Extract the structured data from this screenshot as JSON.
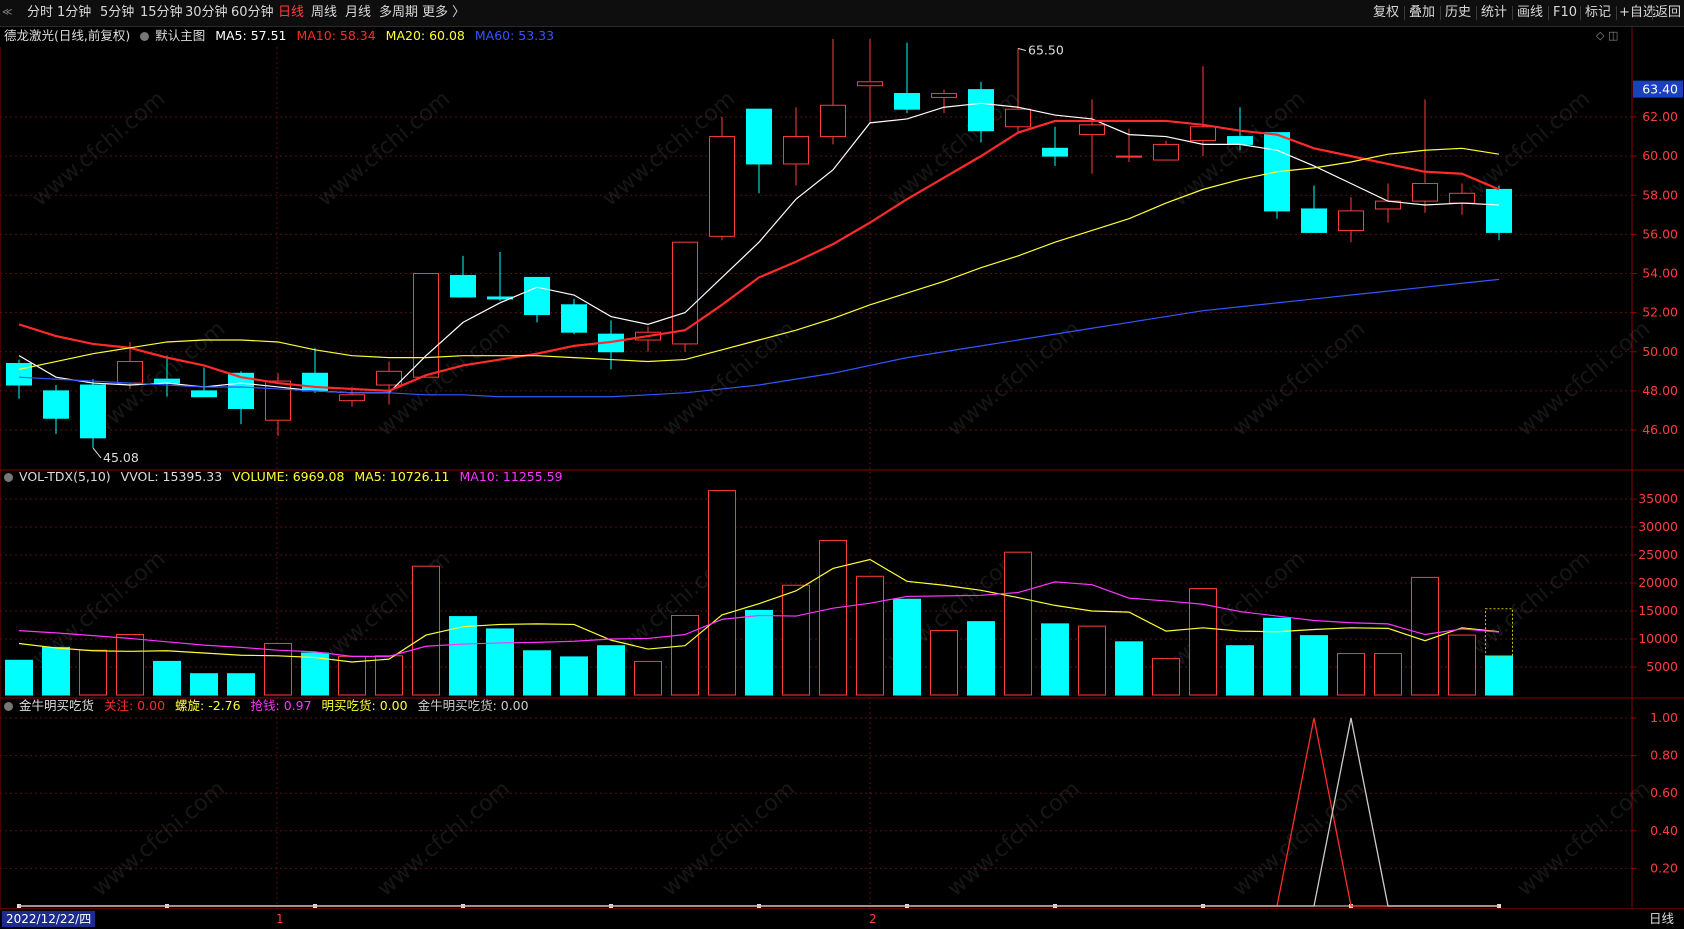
{
  "toolbar": {
    "left_items": [
      "分时",
      "1分钟",
      "5分钟",
      "15分钟",
      "30分钟",
      "60分钟",
      "日线",
      "周线",
      "月线",
      "多周期",
      "更多 〉"
    ],
    "active_item": "日线",
    "right_items": [
      "复权",
      "叠加",
      "历史",
      "统计",
      "画线",
      "F10",
      "标记",
      "+自选",
      "返回"
    ]
  },
  "main_panel": {
    "stock_label": "德龙激光(日线,前复权)",
    "template_label": "默认主图",
    "ma5": {
      "label": "MA5: 57.51",
      "color": "#ffffff"
    },
    "ma10": {
      "label": "MA10: 58.34",
      "color": "#ff2a2a"
    },
    "ma20": {
      "label": "MA20: 60.08",
      "color": "#ffff33"
    },
    "ma60": {
      "label": "MA60: 53.33",
      "color": "#3355ff"
    },
    "last_price_tag": "63.40"
  },
  "volume_panel": {
    "title": "VOL-TDX(5,10)",
    "vvol": "VVOL: 15395.33",
    "volume": "VOLUME: 6969.08",
    "ma5": "MA5: 10726.11",
    "ma10": "MA10: 11255.59"
  },
  "indicator_panel": {
    "title": "金牛明买吃货",
    "guanzhu": "关注: 0.00",
    "luoxuan": "螺旋: -2.76",
    "qiangqian": "抢钱: 0.97",
    "mingmai": "明买吃货: 0.00",
    "jinniu": "金牛明买吃货: 0.00"
  },
  "bottom": {
    "date": "2022/12/22/四",
    "period": "日线",
    "month_markers": [
      "1",
      "2"
    ]
  },
  "chart_data": [
    {
      "type": "candlestick",
      "title": "德龙激光(日线,前复权)",
      "ylim": [
        44.0,
        67.0
      ],
      "yticks": [
        46.0,
        48.0,
        50.0,
        52.0,
        54.0,
        56.0,
        58.0,
        60.0,
        62.0
      ],
      "annotations": [
        {
          "text": "65.50",
          "type": "high",
          "index": 27
        },
        {
          "text": "45.08",
          "type": "low",
          "index": 2
        }
      ],
      "candles": [
        {
          "o": 49.4,
          "h": 49.6,
          "l": 47.6,
          "c": 48.3
        },
        {
          "o": 48.0,
          "h": 48.3,
          "l": 45.8,
          "c": 46.6
        },
        {
          "o": 48.3,
          "h": 48.6,
          "l": 45.08,
          "c": 45.6
        },
        {
          "o": 48.4,
          "h": 50.5,
          "l": 48.1,
          "c": 49.5
        },
        {
          "o": 48.6,
          "h": 49.8,
          "l": 47.7,
          "c": 48.4
        },
        {
          "o": 48.0,
          "h": 49.2,
          "l": 47.8,
          "c": 47.7
        },
        {
          "o": 48.9,
          "h": 49.0,
          "l": 46.3,
          "c": 47.1
        },
        {
          "o": 46.5,
          "h": 48.9,
          "l": 45.7,
          "c": 48.5
        },
        {
          "o": 48.9,
          "h": 50.2,
          "l": 47.9,
          "c": 48.0
        },
        {
          "o": 47.5,
          "h": 48.2,
          "l": 47.2,
          "c": 47.8
        },
        {
          "o": 48.3,
          "h": 49.5,
          "l": 47.3,
          "c": 49.0
        },
        {
          "o": 48.7,
          "h": 54.0,
          "l": 48.7,
          "c": 54.0
        },
        {
          "o": 53.9,
          "h": 54.9,
          "l": 52.8,
          "c": 52.8
        },
        {
          "o": 52.8,
          "h": 55.1,
          "l": 52.6,
          "c": 52.7
        },
        {
          "o": 53.8,
          "h": 53.8,
          "l": 51.5,
          "c": 51.9
        },
        {
          "o": 52.4,
          "h": 52.7,
          "l": 50.9,
          "c": 51.0
        },
        {
          "o": 50.9,
          "h": 51.6,
          "l": 49.1,
          "c": 50.0
        },
        {
          "o": 50.6,
          "h": 51.3,
          "l": 50.0,
          "c": 51.0
        },
        {
          "o": 50.4,
          "h": 55.6,
          "l": 50.0,
          "c": 55.6
        },
        {
          "o": 55.9,
          "h": 62.0,
          "l": 55.7,
          "c": 61.0
        },
        {
          "o": 62.4,
          "h": 62.4,
          "l": 58.1,
          "c": 59.6
        },
        {
          "o": 59.6,
          "h": 62.5,
          "l": 58.5,
          "c": 61.0
        },
        {
          "o": 61.0,
          "h": 66.0,
          "l": 60.6,
          "c": 62.6
        },
        {
          "o": 63.6,
          "h": 66.0,
          "l": 61.7,
          "c": 63.8
        },
        {
          "o": 63.2,
          "h": 65.8,
          "l": 62.2,
          "c": 62.4
        },
        {
          "o": 63.0,
          "h": 63.4,
          "l": 62.2,
          "c": 63.2
        },
        {
          "o": 63.4,
          "h": 63.8,
          "l": 60.7,
          "c": 61.3
        },
        {
          "o": 61.5,
          "h": 65.5,
          "l": 61.2,
          "c": 62.4
        },
        {
          "o": 60.4,
          "h": 61.5,
          "l": 59.5,
          "c": 60.0
        },
        {
          "o": 61.1,
          "h": 62.9,
          "l": 59.1,
          "c": 61.6
        },
        {
          "o": 60.0,
          "h": 61.4,
          "l": 59.7,
          "c": 60.0
        },
        {
          "o": 59.8,
          "h": 60.8,
          "l": 59.8,
          "c": 60.6
        },
        {
          "o": 60.8,
          "h": 64.6,
          "l": 60.0,
          "c": 61.5
        },
        {
          "o": 61.0,
          "h": 62.5,
          "l": 60.3,
          "c": 60.6
        },
        {
          "o": 61.2,
          "h": 61.2,
          "l": 56.8,
          "c": 57.2
        },
        {
          "o": 57.3,
          "h": 58.5,
          "l": 56.1,
          "c": 56.1
        },
        {
          "o": 56.2,
          "h": 57.9,
          "l": 55.6,
          "c": 57.2
        },
        {
          "o": 57.3,
          "h": 58.6,
          "l": 56.6,
          "c": 57.7
        },
        {
          "o": 57.7,
          "h": 62.9,
          "l": 57.1,
          "c": 58.6
        },
        {
          "o": 57.6,
          "h": 58.6,
          "l": 57.0,
          "c": 58.1
        },
        {
          "o": 58.3,
          "h": 58.5,
          "l": 55.7,
          "c": 56.1
        }
      ],
      "series": [
        {
          "name": "MA5",
          "color": "#ffffff",
          "values": [
            49.8,
            48.7,
            48.4,
            48.3,
            48.4,
            48.2,
            48.4,
            48.2,
            48.0,
            47.9,
            47.9,
            49.8,
            51.5,
            52.5,
            53.3,
            52.9,
            51.8,
            51.4,
            52.0,
            53.8,
            55.6,
            57.8,
            59.3,
            61.7,
            61.9,
            62.5,
            62.7,
            62.5,
            62.1,
            61.9,
            61.1,
            61.0,
            60.6,
            60.6,
            60.3,
            59.5,
            58.6,
            57.7,
            57.5,
            57.6,
            57.5
          ]
        },
        {
          "name": "MA10",
          "color": "#ff2a2a",
          "values": [
            51.4,
            50.8,
            50.4,
            50.2,
            49.7,
            49.3,
            48.7,
            48.4,
            48.2,
            48.1,
            48.0,
            48.8,
            49.3,
            49.6,
            49.9,
            50.3,
            50.5,
            50.8,
            51.1,
            52.4,
            53.8,
            54.6,
            55.5,
            56.6,
            57.8,
            58.9,
            60.0,
            61.2,
            61.8,
            61.8,
            61.8,
            61.8,
            61.6,
            61.3,
            61.1,
            60.4,
            60.0,
            59.6,
            59.2,
            59.1,
            58.3
          ]
        },
        {
          "name": "MA20",
          "color": "#ffff33",
          "values": [
            49.1,
            49.5,
            49.9,
            50.2,
            50.5,
            50.6,
            50.6,
            50.5,
            50.1,
            49.8,
            49.7,
            49.7,
            49.8,
            49.8,
            49.8,
            49.7,
            49.6,
            49.5,
            49.6,
            50.1,
            50.6,
            51.1,
            51.7,
            52.4,
            53.0,
            53.6,
            54.3,
            54.9,
            55.6,
            56.2,
            56.8,
            57.6,
            58.3,
            58.8,
            59.2,
            59.4,
            59.7,
            60.1,
            60.3,
            60.4,
            60.1
          ]
        },
        {
          "name": "MA60",
          "color": "#3355ff",
          "values": [
            48.7,
            48.6,
            48.5,
            48.4,
            48.3,
            48.2,
            48.2,
            48.1,
            48.0,
            47.9,
            47.9,
            47.8,
            47.8,
            47.7,
            47.7,
            47.7,
            47.7,
            47.8,
            47.9,
            48.1,
            48.3,
            48.6,
            48.9,
            49.3,
            49.7,
            50.0,
            50.3,
            50.6,
            50.9,
            51.2,
            51.5,
            51.8,
            52.1,
            52.3,
            52.5,
            52.7,
            52.9,
            53.1,
            53.3,
            53.5,
            53.7
          ]
        }
      ]
    },
    {
      "type": "bar",
      "title": "VOL-TDX(5,10)",
      "ylim": [
        0,
        37000
      ],
      "yticks": [
        5000,
        10000,
        15000,
        20000,
        25000,
        30000,
        35000
      ],
      "values": [
        6200,
        8500,
        8000,
        10800,
        6000,
        3800,
        3800,
        9200,
        7500,
        6900,
        7000,
        23000,
        14000,
        11800,
        7900,
        6800,
        8800,
        6000,
        14200,
        36500,
        15100,
        19600,
        27600,
        21200,
        17100,
        11500,
        13100,
        25500,
        12700,
        12300,
        9500,
        6500,
        19000,
        8800,
        13700,
        10600,
        7400,
        7400,
        21000,
        10700,
        6969.08
      ],
      "up": [
        false,
        false,
        true,
        true,
        false,
        false,
        false,
        true,
        false,
        true,
        true,
        true,
        false,
        false,
        false,
        false,
        false,
        true,
        true,
        true,
        false,
        true,
        true,
        true,
        false,
        true,
        false,
        true,
        false,
        true,
        false,
        true,
        true,
        false,
        false,
        false,
        true,
        true,
        true,
        true,
        false
      ],
      "series": [
        {
          "name": "MA5",
          "color": "#ffff33",
          "values": [
            9200,
            8400,
            7900,
            7800,
            7900,
            7500,
            7100,
            7000,
            6700,
            5900,
            6400,
            10700,
            12200,
            12600,
            12700,
            12600,
            9800,
            8200,
            8800,
            14300,
            16300,
            18600,
            22600,
            24200,
            20300,
            19600,
            18700,
            17400,
            16000,
            15000,
            14800,
            11400,
            12000,
            11400,
            11300,
            11700,
            12000,
            11900,
            9700,
            12000,
            11300
          ]
        },
        {
          "name": "MA10",
          "color": "#ff33ff",
          "values": [
            11500,
            11100,
            10600,
            10100,
            9500,
            8900,
            8500,
            8000,
            7700,
            6900,
            6900,
            8700,
            9100,
            9300,
            9400,
            9600,
            10000,
            10100,
            10800,
            13500,
            14200,
            14100,
            15500,
            16400,
            17600,
            17700,
            17800,
            18300,
            20200,
            19700,
            17300,
            16800,
            16200,
            14900,
            14100,
            13300,
            12900,
            12700,
            10800,
            11800,
            11255.59
          ]
        }
      ]
    },
    {
      "type": "line",
      "title": "金牛明买吃货",
      "ylim": [
        0,
        1.1
      ],
      "yticks": [
        0.2,
        0.4,
        0.6,
        0.8,
        1.0
      ],
      "series": [
        {
          "name": "关注",
          "color": "#ff2a2a",
          "values": [
            0,
            0,
            0,
            0,
            0,
            0,
            0,
            0,
            0,
            0,
            0,
            0,
            0,
            0,
            0,
            0,
            0,
            0,
            0,
            0,
            0,
            0,
            0,
            0,
            0,
            0,
            0,
            0,
            0,
            0,
            0,
            0,
            0,
            0,
            0,
            1,
            0,
            0,
            0,
            0,
            0
          ]
        },
        {
          "name": "抢钱",
          "color": "#cccccc",
          "values": [
            0,
            0,
            0,
            0,
            0,
            0,
            0,
            0,
            0,
            0,
            0,
            0,
            0,
            0,
            0,
            0,
            0,
            0,
            0,
            0,
            0,
            0,
            0,
            0,
            0,
            0,
            0,
            0,
            0,
            0,
            0,
            0,
            0,
            0,
            0,
            0,
            1,
            0,
            0,
            0,
            0
          ]
        }
      ]
    }
  ]
}
